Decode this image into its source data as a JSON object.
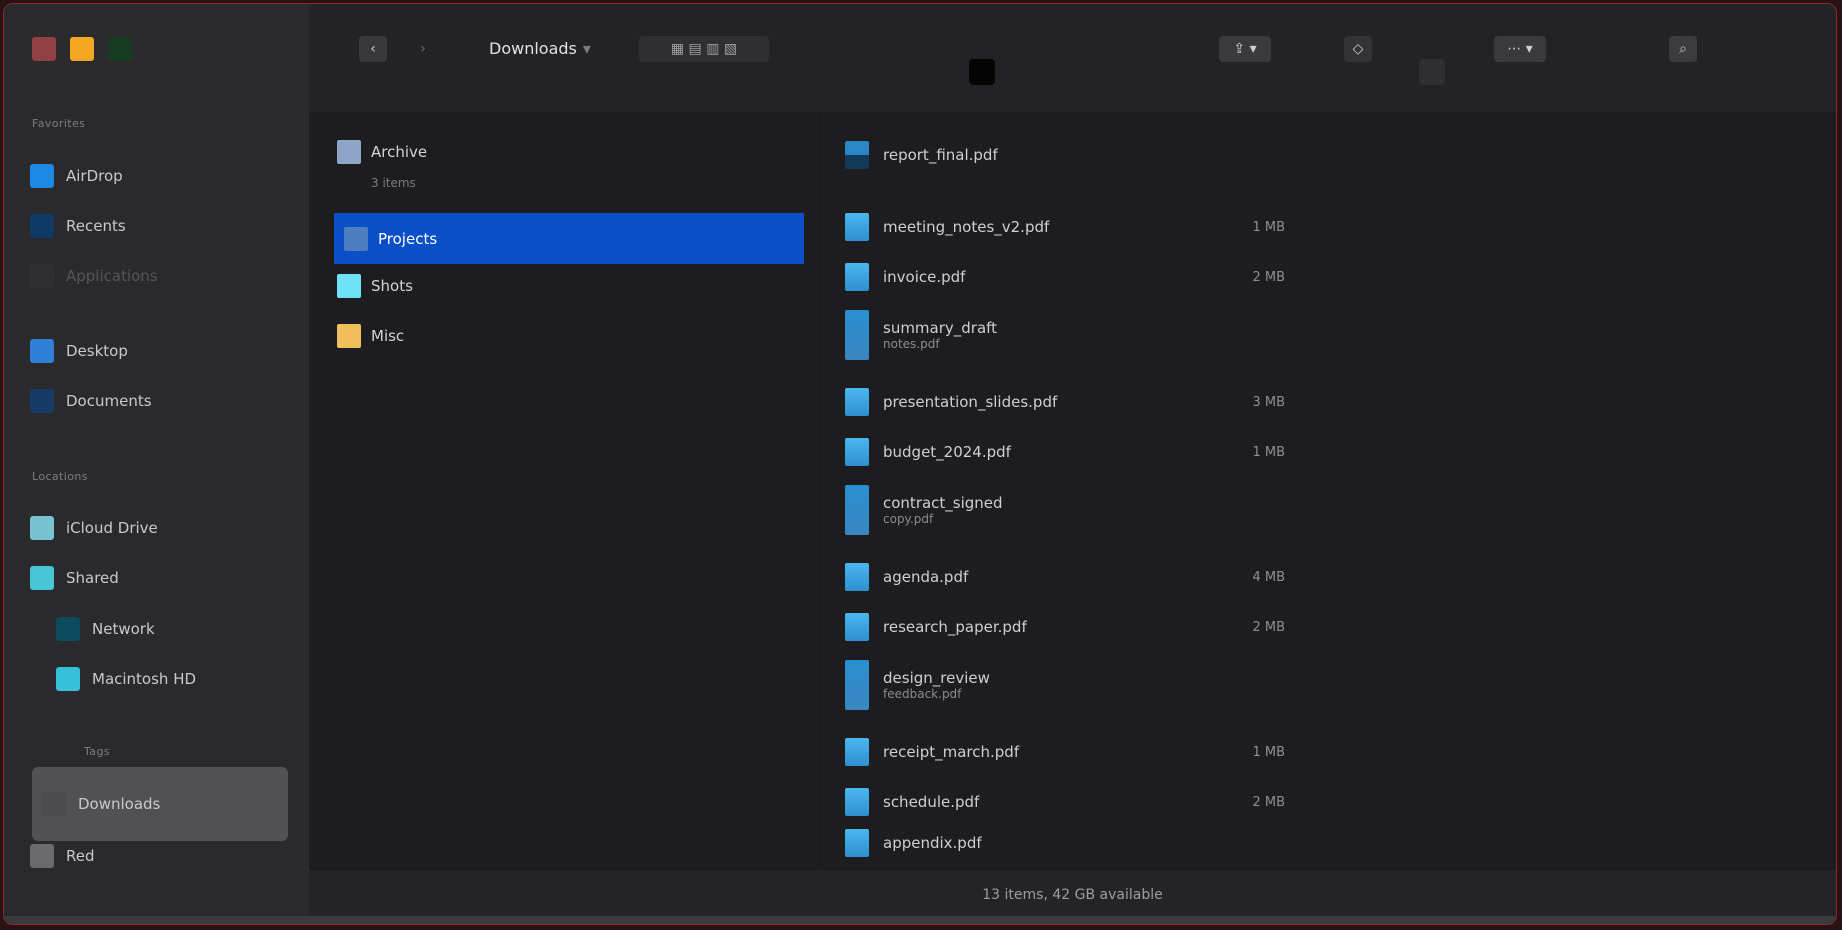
{
  "window": {
    "title": "Downloads"
  },
  "toolbar": {
    "back_icon": "chevron-left-icon",
    "forward_icon": "chevron-right-icon",
    "title": "Downloads",
    "subtitle": "▾",
    "view_label": "▦ ▤ ▥ ▧",
    "share_label": "⇪ ▾",
    "tag_label": "◇",
    "more_label": "⋯ ▾",
    "search_label": "⌕"
  },
  "sidebar": {
    "sections": [
      {
        "header": "Favorites",
        "items": [
          {
            "label": "AirDrop",
            "color": "#1e88e5",
            "icon": "airdrop-icon"
          },
          {
            "label": "Recents",
            "color": "#0f3a66",
            "icon": "clock-icon"
          },
          {
            "label": "Applications",
            "color": "#2a2a2d",
            "icon": "apps-icon"
          }
        ]
      },
      {
        "header": "",
        "items": [
          {
            "label": "Desktop",
            "color": "#2f7fd6",
            "icon": "desktop-icon"
          },
          {
            "label": "Documents",
            "color": "#163c66",
            "icon": "document-icon"
          }
        ]
      },
      {
        "header": "Locations",
        "items": [
          {
            "label": "iCloud Drive",
            "color": "#78c1cf",
            "icon": "cloud-icon"
          },
          {
            "label": "Shared",
            "color": "#49c3d6",
            "icon": "shared-folder-icon"
          },
          {
            "label": "Network",
            "color": "#0c4a5e",
            "icon": "network-icon"
          },
          {
            "label": "Macintosh HD",
            "color": "#35c1d9",
            "icon": "disk-icon"
          }
        ]
      },
      {
        "header": "Tags",
        "items": [
          {
            "label": "Downloads",
            "color": "#4b4b50",
            "icon": "download-icon",
            "selected": true
          },
          {
            "label": "Red",
            "color": "#6a6a6f",
            "icon": "tag-icon"
          }
        ]
      }
    ]
  },
  "column1": {
    "items": [
      {
        "label": "Archive",
        "sub": "3 items",
        "color": "#8ea5c8",
        "icon": "folder-icon"
      },
      {
        "label": "Projects",
        "color": "#4d7fc0",
        "icon": "folder-icon",
        "selected": true
      },
      {
        "label": "Shots",
        "color": "#6ee2f5",
        "icon": "folder-icon"
      },
      {
        "label": "Misc",
        "color": "#f0be5a",
        "icon": "folder-icon"
      }
    ]
  },
  "column2": {
    "items": [
      {
        "name": "report_final.pdf",
        "size": "",
        "style": "dark"
      },
      {
        "name": "meeting_notes_v2.pdf",
        "size": "1 MB",
        "style": ""
      },
      {
        "name": "invoice.pdf",
        "size": "2 MB",
        "style": ""
      },
      {
        "name": "summary_draft",
        "sub": "notes.pdf",
        "size": "",
        "style": "tall"
      },
      {
        "name": "presentation_slides.pdf",
        "size": "3 MB",
        "style": ""
      },
      {
        "name": "budget_2024.pdf",
        "size": "1 MB",
        "style": ""
      },
      {
        "name": "contract_signed",
        "sub": "copy.pdf",
        "size": "",
        "style": "tall"
      },
      {
        "name": "agenda.pdf",
        "size": "4 MB",
        "style": ""
      },
      {
        "name": "research_paper.pdf",
        "size": "2 MB",
        "style": ""
      },
      {
        "name": "design_review",
        "sub": "feedback.pdf",
        "size": "",
        "style": "tall"
      },
      {
        "name": "receipt_march.pdf",
        "size": "1 MB",
        "style": ""
      },
      {
        "name": "schedule.pdf",
        "size": "2 MB",
        "style": ""
      },
      {
        "name": "appendix.pdf",
        "size": "",
        "style": ""
      }
    ]
  },
  "statusbar": {
    "text": "13 items, 42 GB available"
  }
}
